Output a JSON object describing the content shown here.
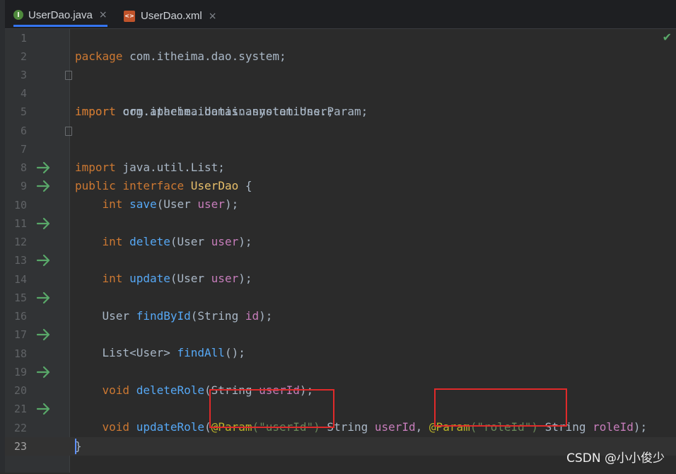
{
  "tabs": [
    {
      "label": "UserDao.java",
      "icon": "interface-file-icon",
      "active": true
    },
    {
      "label": "UserDao.xml",
      "icon": "xml-file-icon",
      "active": false
    }
  ],
  "tab_close_glyph": "×",
  "inspection_status_glyph": "✔",
  "line_numbers": [
    "1",
    "2",
    "3",
    "4",
    "5",
    "6",
    "7",
    "8",
    "9",
    "10",
    "11",
    "12",
    "13",
    "14",
    "15",
    "16",
    "17",
    "18",
    "19",
    "20",
    "21",
    "22",
    "23"
  ],
  "code": {
    "l1": {
      "kw": "package",
      "rest": " com.itheima.dao.system;"
    },
    "l3": {
      "kw": "import",
      "rest": " com.itheima.domain.system.User;"
    },
    "l4": {
      "kw": "import",
      "rest": " org.apache.ibatis.annotations.Param;"
    },
    "l6": {
      "kw": "import",
      "rest": " java.util.List;"
    },
    "l8": {
      "kw1": "public",
      "kw2": "interface",
      "name": "UserDao",
      "brace": " {"
    },
    "l9": {
      "type": "int",
      "method": "save",
      "open": "(User ",
      "param": "user",
      "close": ");"
    },
    "l11": {
      "type": "int",
      "method": "delete",
      "open": "(User ",
      "param": "user",
      "close": ");"
    },
    "l13": {
      "type": "int",
      "method": "update",
      "open": "(User ",
      "param": "user",
      "close": ");"
    },
    "l15": {
      "type": "User ",
      "method": "findById",
      "open": "(String ",
      "param": "id",
      "close": ");"
    },
    "l17": {
      "type": "List<User> ",
      "method": "findAll",
      "close": "();"
    },
    "l19": {
      "type": "void",
      "method": "deleteRole",
      "open": "(String ",
      "param": "userId",
      "close": ");"
    },
    "l21": {
      "type": "void",
      "method": "updateRole",
      "open": "(",
      "anno1": "@Param",
      "str1": "(\"userId\")",
      "mid1": " String ",
      "param1": "userId",
      "comma": ", ",
      "anno2": "@Param",
      "str2": "(\"roleId\")",
      "mid2": " String ",
      "param2": "roleId",
      "close": ");"
    },
    "l22": {
      "brace": "}"
    }
  },
  "watermark": "CSDN @小小俊少",
  "colors": {
    "keyword": "#cc7832",
    "method": "#56a8f5",
    "parameter": "#c77dbb",
    "string": "#6a8759",
    "annotation": "#bbb529",
    "highlight_box": "#e02a2a",
    "implemented_marker": "#59a869"
  }
}
